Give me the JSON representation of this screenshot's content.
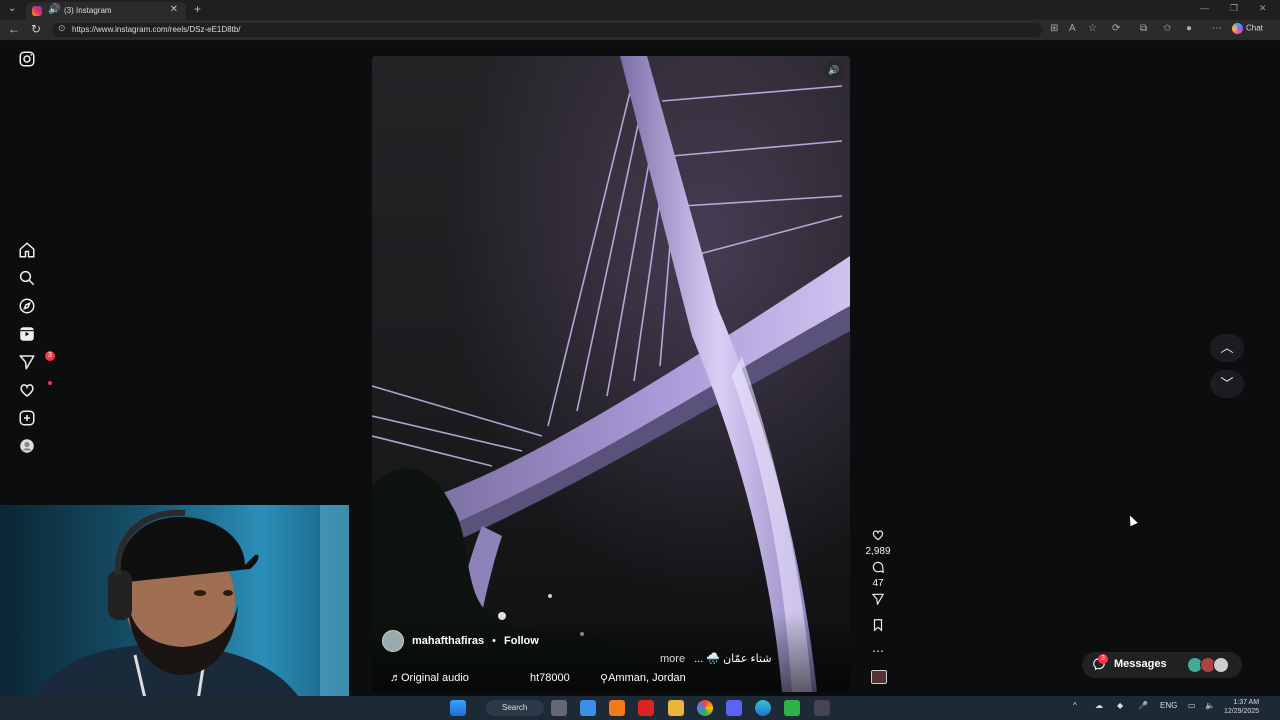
{
  "browser": {
    "tab_title": "(3) Instagram",
    "url": "https://www.instagram.com/reels/DSz-eE1D8tb/",
    "chat_label": "Chat"
  },
  "sidebar": {
    "items": [
      {
        "name": "home",
        "badge": ""
      },
      {
        "name": "search",
        "badge": ""
      },
      {
        "name": "explore",
        "badge": ""
      },
      {
        "name": "reels",
        "badge": ""
      },
      {
        "name": "messages",
        "badge": "3"
      },
      {
        "name": "notifications",
        "badge": ""
      },
      {
        "name": "create",
        "badge": ""
      },
      {
        "name": "profile",
        "badge": ""
      }
    ]
  },
  "reel": {
    "username": "mahafthafiras",
    "separator": "•",
    "follow_label": "Follow",
    "caption": "شتاء عمّان 🌧️ ...",
    "more_label": "more",
    "audio": "Original audio",
    "tag": "ht78000",
    "location": "Amman, Jordan"
  },
  "actions": {
    "likes": "2,989",
    "comments": "47"
  },
  "messages_pill": {
    "label": "Messages",
    "badge": "3"
  },
  "taskbar": {
    "search_label": "Search",
    "lang": "ENG",
    "time": "1:37 AM",
    "date": "12/29/2025"
  },
  "colors": {
    "accent_badge": "#ff3040",
    "bridge_light": "#b9a6e6"
  }
}
